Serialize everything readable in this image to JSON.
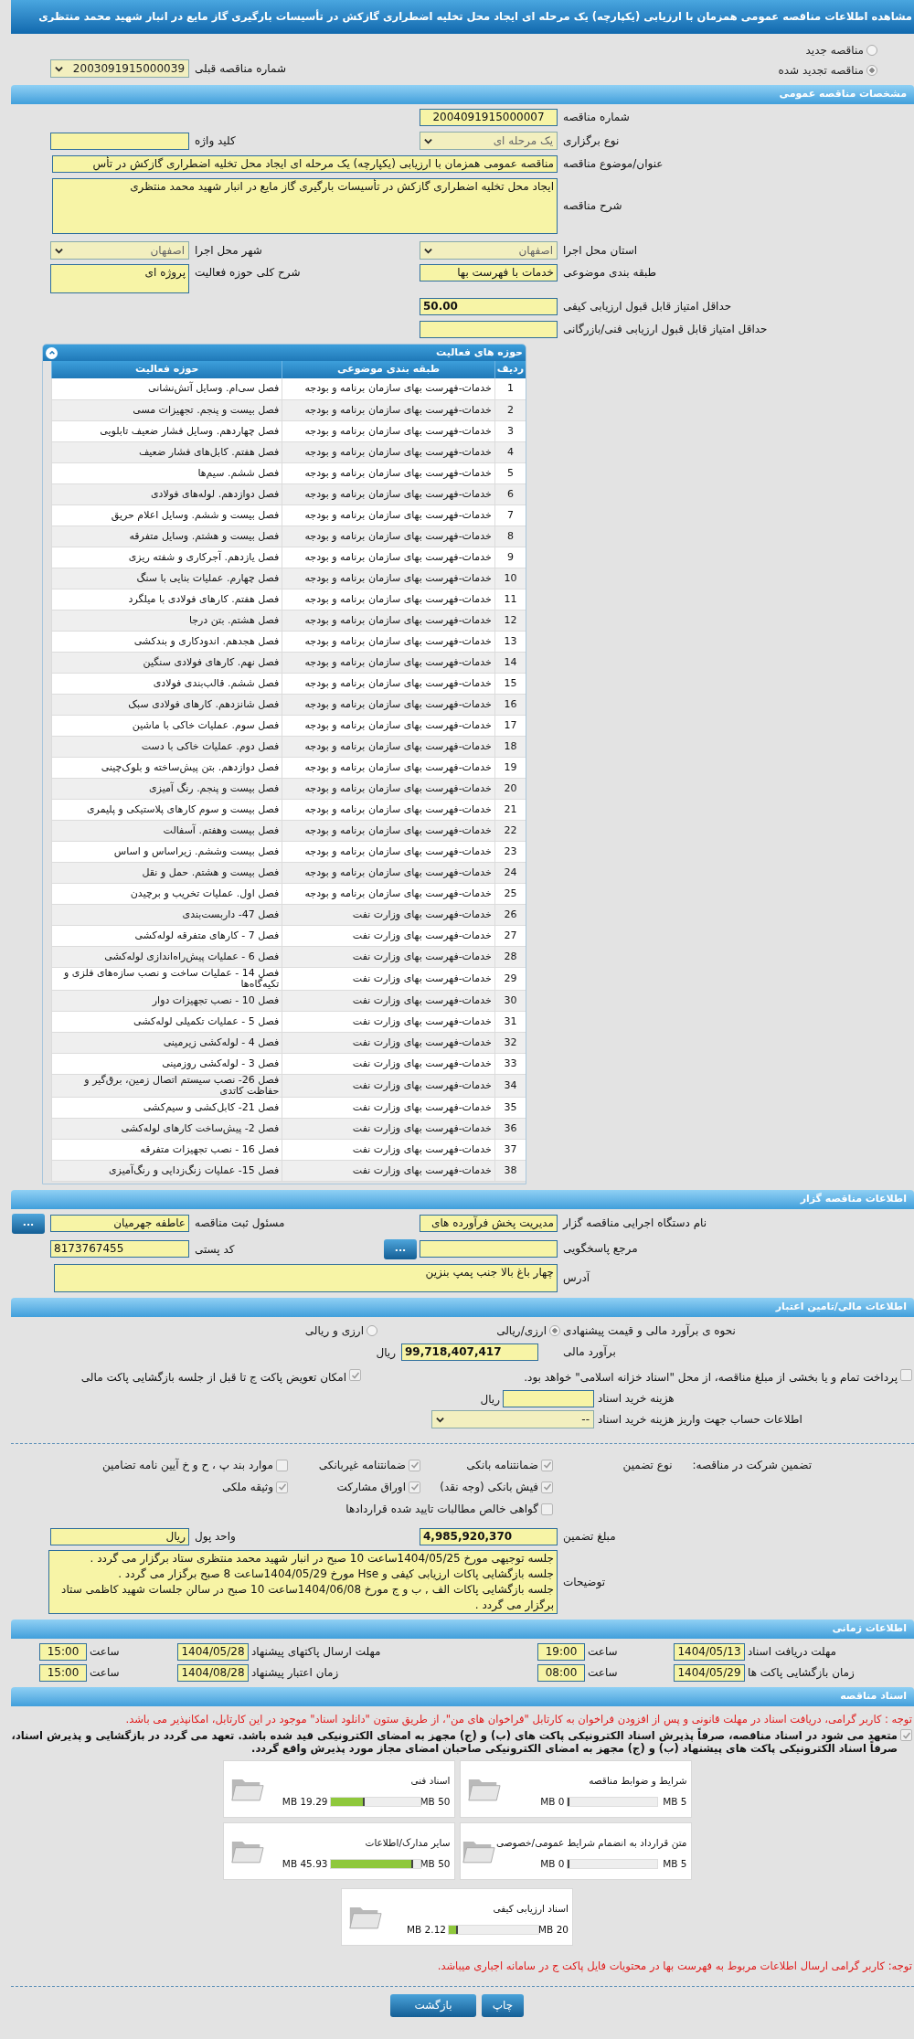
{
  "header": {
    "title": "مشاهده اطلاعات مناقصه عمومی همزمان با ارزیابی (یکپارچه) یک مرحله ای ایجاد محل تخلیه اضطراری گازکش در تأسیسات بارگیری گاز مایع در انبار شهید محمد منتظری"
  },
  "tender_status": [
    {
      "label": "مناقصه جدید",
      "selected": false
    },
    {
      "label": "مناقصه تجدید شده",
      "selected": true
    }
  ],
  "previous_tender": {
    "label": "شماره مناقصه قبلی",
    "value": "2003091915000039"
  },
  "general": {
    "title": "مشخصات مناقصه عمومی",
    "tender_number": {
      "label": "شماره مناقصه",
      "value": "2004091915000007"
    },
    "holding_type": {
      "label": "نوع برگزاری",
      "value": "یک مرحله ای"
    },
    "keyword": {
      "label": "کلید واژه"
    },
    "subject": {
      "label": "عنوان/موضوع مناقصه",
      "value": "مناقصه عمومی همزمان با ارزیابی (یکپارچه) یک مرحله ای ایجاد محل تخلیه اضطراری گازکش در تأس"
    },
    "description": {
      "label": "شرح مناقصه",
      "value": "ایجاد محل تخلیه اضطراری گازکش در تأسیسات بارگیری گاز مایع در انبار شهید محمد منتظری"
    },
    "province": {
      "label": "استان محل اجرا",
      "value": "اصفهان"
    },
    "city": {
      "label": "شهر محل اجرا",
      "value": "اصفهان"
    },
    "category": {
      "label": "طبقه بندی موضوعی",
      "value": "خدمات با فهرست بها"
    },
    "activity_summary": {
      "label": "شرح کلی حوزه فعالیت",
      "value": "پروژه ای"
    },
    "min_quality_score": {
      "label": "حداقل امتیاز قابل قبول ارزیابی کیفی",
      "value": "50.00"
    },
    "min_technical_score": {
      "label": "حداقل امتیاز قابل قبول ارزیابی فنی/بازرگانی"
    }
  },
  "activities": {
    "title": "حوزه های فعالیت",
    "columns": [
      "ردیف",
      "طبقه بندی موضوعی",
      "حوزه فعالیت"
    ],
    "rows": [
      [
        "1",
        "خدمات-فهرست بهای سازمان برنامه و بودجه",
        "فصل سی‌ام. وسایل آتش‌نشانی"
      ],
      [
        "2",
        "خدمات-فهرست بهای سازمان برنامه و بودجه",
        "فصل بیست و پنجم. تجهیزات مسی"
      ],
      [
        "3",
        "خدمات-فهرست بهای سازمان برنامه و بودجه",
        "فصل چهاردهم. وسایل فشار ضعیف تابلویی"
      ],
      [
        "4",
        "خدمات-فهرست بهای سازمان برنامه و بودجه",
        "فصل هفتم. کابل‌های فشار ضعیف"
      ],
      [
        "5",
        "خدمات-فهرست بهای سازمان برنامه و بودجه",
        "فصل ششم. سیم‌ها"
      ],
      [
        "6",
        "خدمات-فهرست بهای سازمان برنامه و بودجه",
        "فصل دوازدهم. لوله‌های فولادی"
      ],
      [
        "7",
        "خدمات-فهرست بهای سازمان برنامه و بودجه",
        "فصل بیست و ششم. وسایل اعلام حریق"
      ],
      [
        "8",
        "خدمات-فهرست بهای سازمان برنامه و بودجه",
        "فصل بیست و هشتم. وسایل متفرقه"
      ],
      [
        "9",
        "خدمات-فهرست بهای سازمان برنامه و بودجه",
        "فصل یازدهم. آجرکاری و شفته ریزی"
      ],
      [
        "10",
        "خدمات-فهرست بهای سازمان برنامه و بودجه",
        "فصل چهارم. عملیات بنایی با سنگ"
      ],
      [
        "11",
        "خدمات-فهرست بهای سازمان برنامه و بودجه",
        "فصل هفتم. کارهای فولادی با میلگرد"
      ],
      [
        "12",
        "خدمات-فهرست بهای سازمان برنامه و بودجه",
        "فصل هشتم. بتن درجا"
      ],
      [
        "13",
        "خدمات-فهرست بهای سازمان برنامه و بودجه",
        "فصل هجدهم. اندودکاری و بندکشی"
      ],
      [
        "14",
        "خدمات-فهرست بهای سازمان برنامه و بودجه",
        "فصل نهم. کارهای فولادی سنگین"
      ],
      [
        "15",
        "خدمات-فهرست بهای سازمان برنامه و بودجه",
        "فصل ششم. قالب‌بندی فولادی"
      ],
      [
        "16",
        "خدمات-فهرست بهای سازمان برنامه و بودجه",
        "فصل شانزدهم. کارهای فولادی سبک"
      ],
      [
        "17",
        "خدمات-فهرست بهای سازمان برنامه و بودجه",
        "فصل سوم. عملیات خاکی با ماشین"
      ],
      [
        "18",
        "خدمات-فهرست بهای سازمان برنامه و بودجه",
        "فصل دوم. عملیات خاکی با دست"
      ],
      [
        "19",
        "خدمات-فهرست بهای سازمان برنامه و بودجه",
        "فصل دوازدهم. بتن پیش‌ساخته و بلوک‌چینی"
      ],
      [
        "20",
        "خدمات-فهرست بهای سازمان برنامه و بودجه",
        "فصل بیست و پنجم. رنگ آمیزی"
      ],
      [
        "21",
        "خدمات-فهرست بهای سازمان برنامه و بودجه",
        "فصل بیست و سوم کارهای پلاستیکی و پلیمری"
      ],
      [
        "22",
        "خدمات-فهرست بهای سازمان برنامه و بودجه",
        "فصل بیست وهفتم. آسفالت"
      ],
      [
        "23",
        "خدمات-فهرست بهای سازمان برنامه و بودجه",
        "فصل بیست وششم. زیراساس و اساس"
      ],
      [
        "24",
        "خدمات-فهرست بهای سازمان برنامه و بودجه",
        "فصل بیست و هشتم. حمل و نقل"
      ],
      [
        "25",
        "خدمات-فهرست بهای سازمان برنامه و بودجه",
        "فصل اول. عملیات تخریب و برچیدن"
      ],
      [
        "26",
        "خدمات-فهرست بهای وزارت نفت",
        "فصل 47- داربست‌بندی"
      ],
      [
        "27",
        "خدمات-فهرست بهای وزارت نفت",
        "فصل 7 - کارهای متفرقه لوله‌کشی"
      ],
      [
        "28",
        "خدمات-فهرست بهای وزارت نفت",
        "فصل 6 - عملیات پیش‌راه‌اندازی لوله‌کشی"
      ],
      [
        "29",
        "خدمات-فهرست بهای وزارت نفت",
        "فصل 14 - عملیات ساخت و نصب سازه‌های فلزی و تکیه‌گاه‌ها"
      ],
      [
        "30",
        "خدمات-فهرست بهای وزارت نفت",
        "فصل 10 - نصب تجهیزات دوار"
      ],
      [
        "31",
        "خدمات-فهرست بهای وزارت نفت",
        "فصل 5 - عملیات تکمیلی لوله‌کشی"
      ],
      [
        "32",
        "خدمات-فهرست بهای وزارت نفت",
        "فصل 4 - لوله‌کشی زیرمینی"
      ],
      [
        "33",
        "خدمات-فهرست بهای وزارت نفت",
        "فصل 3 - لوله‌کشی روزمینی"
      ],
      [
        "34",
        "خدمات-فهرست بهای وزارت نفت",
        "فصل 26- نصب سیستم اتصال زمین، برق‌گیر و حفاظت کاتدی"
      ],
      [
        "35",
        "خدمات-فهرست بهای وزارت نفت",
        "فصل 21- کابل‌کشی و سیم‌کشی"
      ],
      [
        "36",
        "خدمات-فهرست بهای وزارت نفت",
        "فصل 2- پیش‌ساخت کارهای لوله‌کشی"
      ],
      [
        "37",
        "خدمات-فهرست بهای وزارت نفت",
        "فصل 16 - نصب تجهیزات متفرقه"
      ],
      [
        "38",
        "خدمات-فهرست بهای وزارت نفت",
        "فصل 15- عملیات زنگ‌زدایی و رنگ‌آمیزی"
      ]
    ]
  },
  "client": {
    "title": "اطلاعات مناقصه گزار",
    "organization": {
      "label": "نام دستگاه اجرایی مناقصه گزار",
      "value": "مدیریت پخش فرآورده های"
    },
    "registrar": {
      "label": "مسئول ثبت مناقصه",
      "value": "عاطفه جهرمیان",
      "button": "..."
    },
    "reference": {
      "label": "مرجع پاسخگویی",
      "button": "..."
    },
    "postal_code": {
      "label": "کد پستی",
      "value": "8173767455"
    },
    "address": {
      "label": "آدرس",
      "value": "چهار باغ بالا جنب پمپ بنزین"
    }
  },
  "finance": {
    "title": "اطلاعات مالی/تامین اعتبار",
    "estimate_method": {
      "label": "نحوه ی برآورد مالی و قیمت پیشنهادی",
      "options": [
        {
          "label": "ارزی/ریالی",
          "selected": true
        },
        {
          "label": "ارزی و ریالی",
          "selected": false
        }
      ]
    },
    "estimate": {
      "label": "برآورد مالی",
      "value": "99,718,407,417",
      "unit": "ریال"
    },
    "options": [
      {
        "label": "پرداخت تمام و یا بخشی از مبلغ مناقصه، از محل \"اسناد خزانه اسلامی\" خواهد بود.",
        "checked": false
      },
      {
        "label": "امکان تعویض پاکت ج تا قبل از جلسه بازگشایی پاکت مالی",
        "checked": true
      }
    ],
    "document_fee": {
      "label": "هزینه خرید اسناد",
      "unit": "ریال"
    },
    "fee_account": {
      "label": "اطلاعات حساب جهت واریز هزینه خرید اسناد",
      "value": "--"
    }
  },
  "guarantee": {
    "label": "تضمین شرکت در مناقصه:",
    "type_label": "نوع تضمین",
    "types": [
      {
        "label": "ضمانتنامه بانکی",
        "checked": true
      },
      {
        "label": "ضمانتنامه غیربانکی",
        "checked": true
      },
      {
        "label": "موارد بند پ ، ح و خ آیین نامه تضامین",
        "checked": false
      },
      {
        "label": "فیش بانکی (وجه نقد)",
        "checked": true
      },
      {
        "label": "اوراق مشارکت",
        "checked": true
      },
      {
        "label": "وثیقه ملکی",
        "checked": true
      },
      {
        "label": "گواهی خالص مطالبات تایید شده قراردادها",
        "checked": false
      }
    ],
    "amount": {
      "label": "مبلغ تضمین",
      "value": "4,985,920,370"
    },
    "currency": {
      "label": "واحد پول",
      "value": "ریال"
    },
    "notes": {
      "label": "توضیحات",
      "lines": [
        "جلسه توجیهی مورخ 1404/05/25ساعت 10 صبح در انبار شهید محمد منتظری ستاد برگزار می گردد .",
        "جلسه بازگشایی پاکات ارزیابی کیفی و Hse مورخ 1404/05/29ساعت 8 صبح برگزار می گردد .",
        "جلسه بازگشایی پاکات الف , ب و ج مورخ 1404/06/08ساعت 10 صبح در سالن جلسات شهید کاظمی ستاد برگزار می گردد ."
      ]
    }
  },
  "timing": {
    "title": "اطلاعات زمانی",
    "items": [
      {
        "label": "مهلت دریافت اسناد",
        "date": "1404/05/13",
        "time_label": "ساعت",
        "time": "19:00"
      },
      {
        "label": "مهلت ارسال پاکتهای پیشنهاد",
        "date": "1404/05/28",
        "time_label": "ساعت",
        "time": "15:00"
      },
      {
        "label": "زمان بازگشایی پاکت ها",
        "date": "1404/05/29",
        "time_label": "ساعت",
        "time": "08:00"
      },
      {
        "label": "زمان اعتبار پیشنهاد",
        "date": "1404/08/28",
        "time_label": "ساعت",
        "time": "15:00"
      }
    ]
  },
  "documents": {
    "title": "اسناد مناقصه",
    "notice": "توجه : کاربر گرامی، دریافت اسناد در مهلت قانونی و پس از افزودن فراخوان به کارتابل \"فراخوان های من\"، از طریق ستون \"دانلود اسناد\" موجود در این کارتابل، امکانپذیر می باشد.",
    "commitment": {
      "text": "متعهد می شود در اسناد مناقصه، صرفاً پذیرش اسناد الکترونیکی پاکت های (ب) و (ج) مجهز به امضای الکترونیکی قید شده باشد. تعهد می گردد در بازگشایی و پذیرش اسناد، صرفاً اسناد الکترونیکی پاکت های پیشنهاد (ب) و (ج) مجهز به امضای الکترونیکی صاحبان امضای مجاز مورد پذیرش واقع گردد.",
      "checked": true
    },
    "files": [
      {
        "title": "شرایط و ضوابط مناقصه",
        "used": "0 MB",
        "capacity": "5 MB",
        "level": 0
      },
      {
        "title": "اسناد فنی",
        "used": "19.29 MB",
        "capacity": "50 MB",
        "level": 0.386
      },
      {
        "title": "متن قرارداد به انضمام شرایط عمومی/خصوصی",
        "used": "0 MB",
        "capacity": "5 MB",
        "level": 0
      },
      {
        "title": "سایر مدارک/اطلاعات",
        "used": "45.93 MB",
        "capacity": "50 MB",
        "level": 0.919
      },
      {
        "title": "اسناد ارزیابی کیفی",
        "used": "2.12 MB",
        "capacity": "20 MB",
        "level": 0.106
      }
    ],
    "footer_notice": "توجه: کاربر گرامی ارسال اطلاعات مربوط به فهرست بها در محتویات فایل پاکت ج در سامانه اجباری میباشد."
  },
  "buttons": [
    "چاپ",
    "بازگشت"
  ]
}
